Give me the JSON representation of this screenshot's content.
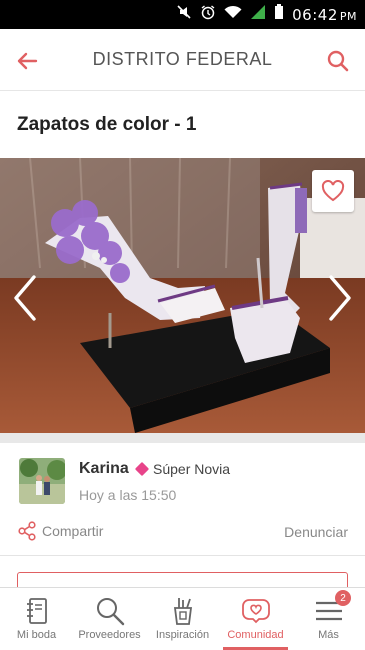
{
  "status_bar": {
    "time": "06:42",
    "ampm": "PM"
  },
  "header": {
    "title": "DISTRITO FEDERAL"
  },
  "post": {
    "title": "Zapatos de color - 1",
    "photo_caption": "",
    "author": {
      "name": "Karina",
      "badge": "Súper Novia",
      "time": "Hoy a las 15:50"
    },
    "share_label": "Compartir",
    "report_label": "Denunciar"
  },
  "nav": {
    "items": [
      {
        "label": "Mi boda",
        "icon": "notebook-icon"
      },
      {
        "label": "Proveedores",
        "icon": "search-icon"
      },
      {
        "label": "Inspiración",
        "icon": "tools-icon"
      },
      {
        "label": "Comunidad",
        "icon": "heart-chat-icon"
      },
      {
        "label": "Más",
        "icon": "menu-icon"
      }
    ],
    "more_badge": "2"
  },
  "colors": {
    "accent": "#e06062",
    "badge": "#e8448a"
  }
}
